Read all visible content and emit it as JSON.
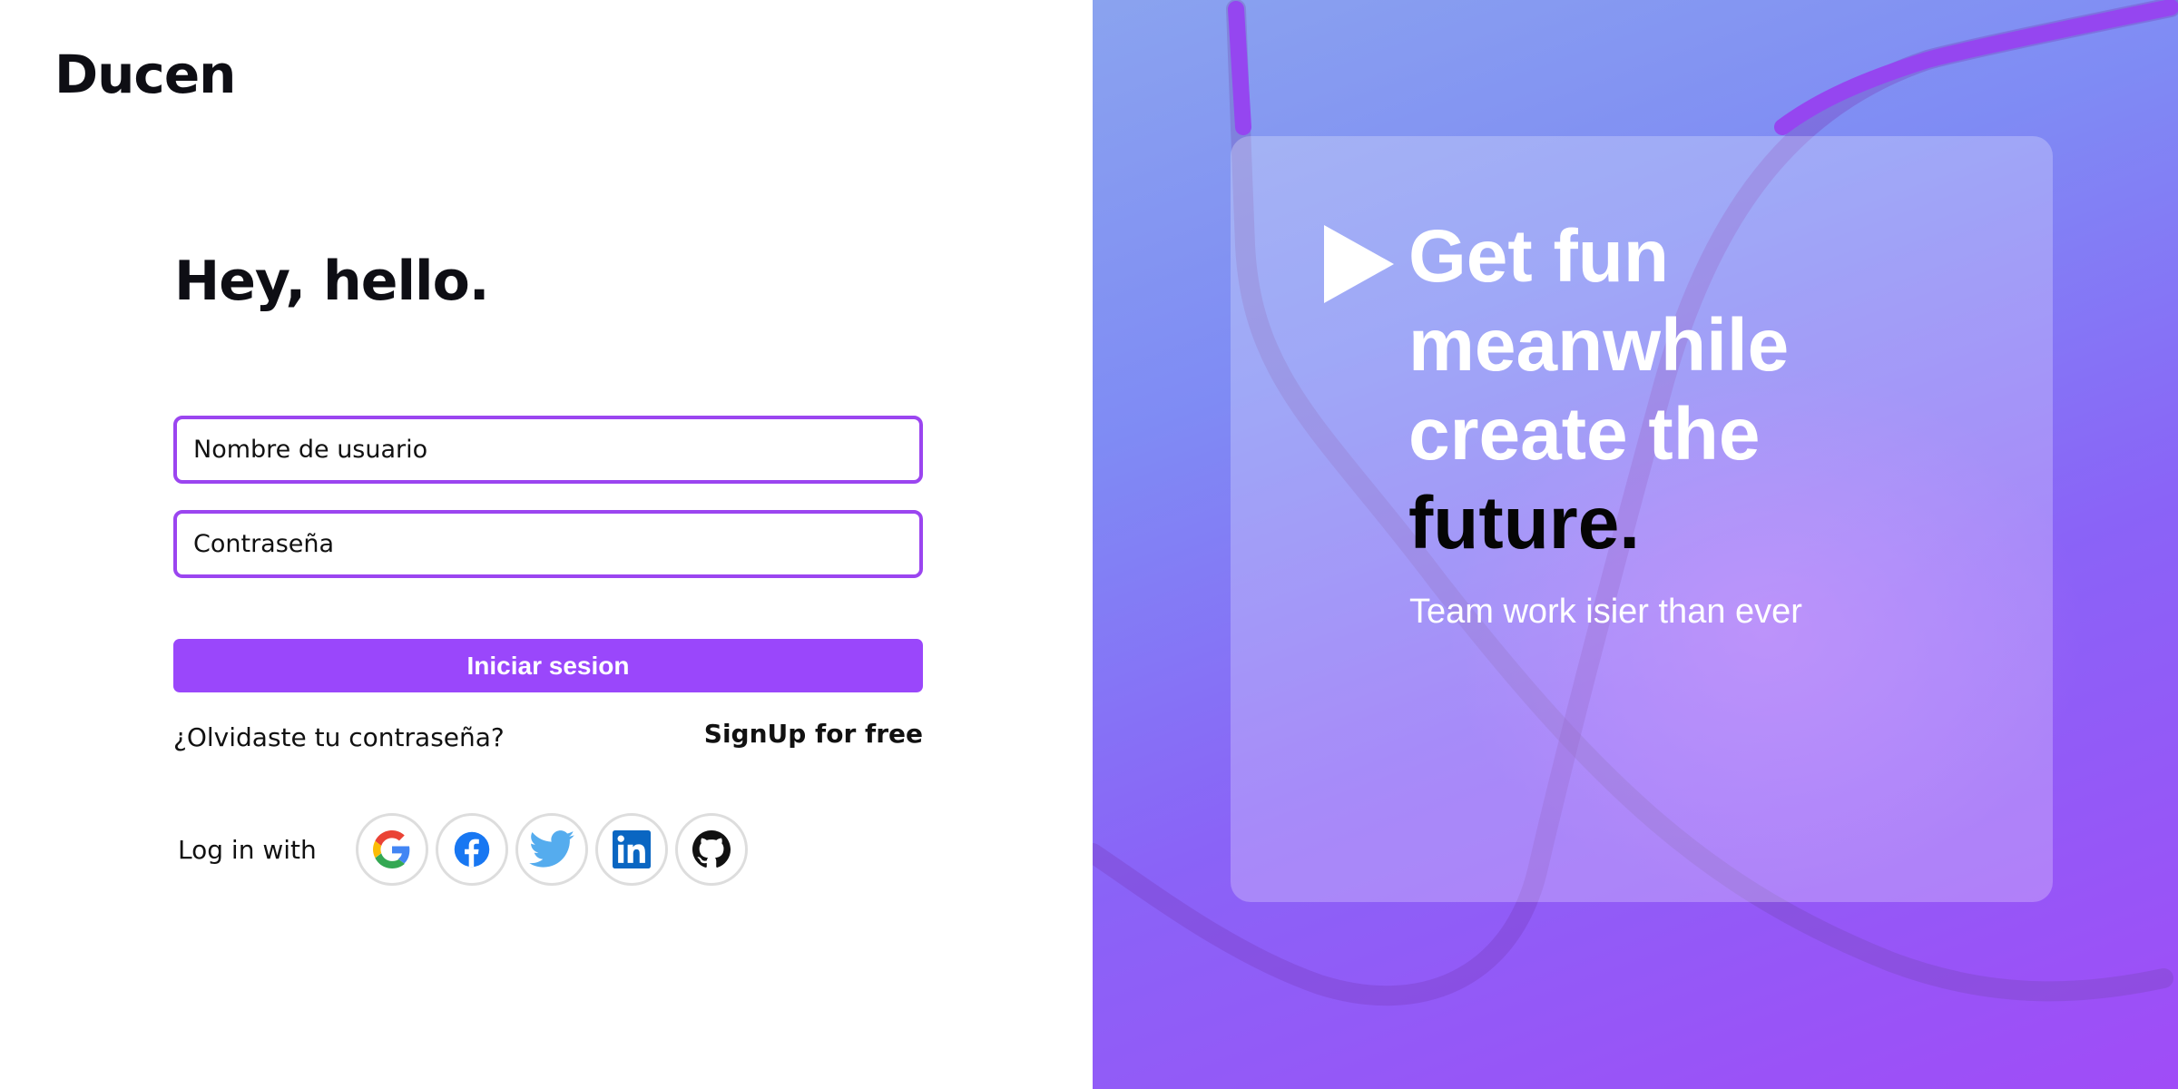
{
  "brand": {
    "name": "Ducen"
  },
  "login": {
    "headline": "Hey, hello.",
    "username_placeholder": "Nombre de usuario",
    "password_placeholder": "Contraseña",
    "submit_label": "Iniciar sesion",
    "forgot_label": "¿Olvidaste tu contraseña?",
    "signup_label": "SignUp for free",
    "social_label": "Log in with",
    "social_providers": [
      "google-icon",
      "facebook-icon",
      "twitter-icon",
      "linkedin-icon",
      "github-icon"
    ]
  },
  "promo": {
    "line1": "Get fun",
    "line2": "meanwhile",
    "line3": "create the",
    "line4": "future.",
    "tagline": "Team work isier than ever",
    "play_icon": "play-icon"
  },
  "colors": {
    "accent": "#9a47fb",
    "field_border": "#9b45f0",
    "text": "#0e0e14",
    "panel_gradient_start": "#8aa3ef",
    "panel_gradient_end": "#a04cf7"
  }
}
